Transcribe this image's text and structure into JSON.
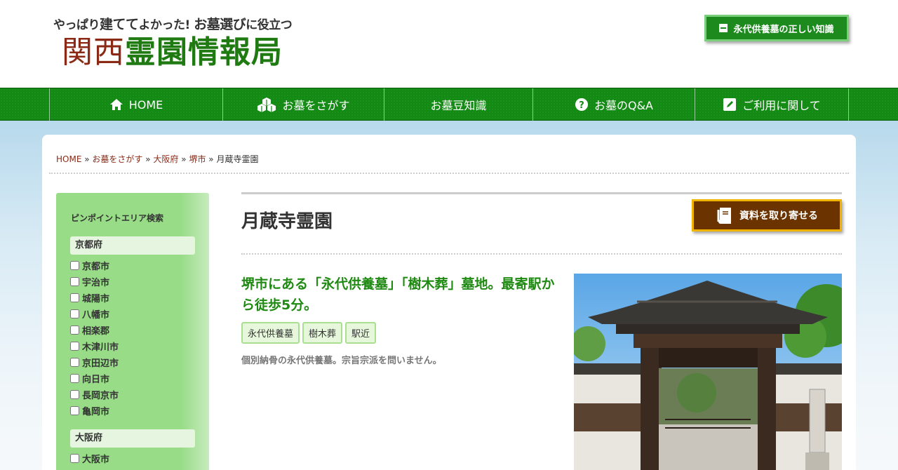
{
  "header": {
    "tagline_part1": "やっぱり",
    "tagline_part2": "建てて",
    "tagline_part3": "よかった!",
    "tagline_part4": "お墓選び",
    "tagline_part5": "に役立つ",
    "site_title_red": "関西",
    "site_title_green": "霊園情報局",
    "knowledge_button": "永代供養墓の正しい知識"
  },
  "nav": {
    "items": [
      {
        "label": "HOME",
        "icon": "home-icon"
      },
      {
        "label": "お墓をさがす",
        "icon": "boxes-icon"
      },
      {
        "label": "お墓豆知識",
        "icon": ""
      },
      {
        "label": "お墓のQ&A",
        "icon": "question-circle-icon"
      },
      {
        "label": "ご利用に関して",
        "icon": "edit-icon"
      }
    ]
  },
  "breadcrumb": {
    "home": "HOME",
    "search": "お墓をさがす",
    "prefecture": "大阪府",
    "city": "堺市",
    "current": "月蔵寺霊園",
    "separator": "»"
  },
  "sidebar": {
    "title": "ピンポイントエリア検索",
    "regions": [
      {
        "name": "京都府",
        "cities": [
          "京都市",
          "宇治市",
          "城陽市",
          "八幡市",
          "相楽郡",
          "木津川市",
          "京田辺市",
          "向日市",
          "長岡京市",
          "亀岡市"
        ]
      },
      {
        "name": "大阪府",
        "cities": [
          "大阪市"
        ]
      }
    ]
  },
  "main": {
    "title": "月蔵寺霊園",
    "request_button": "資料を取り寄せる",
    "catch_copy": "堺市にある「永代供養墓」「樹木葬」墓地。最寄駅から徒歩5分。",
    "tags": [
      "永代供養墓",
      "樹木葬",
      "駅近"
    ],
    "description": "個別納骨の永代供養墓。宗旨宗派を問いません。"
  },
  "colors": {
    "brand_green": "#138a13",
    "accent_brown": "#6a3300",
    "accent_gold": "#f0b400",
    "link_red": "#8a2a16",
    "catch_green": "#1f8a12"
  }
}
